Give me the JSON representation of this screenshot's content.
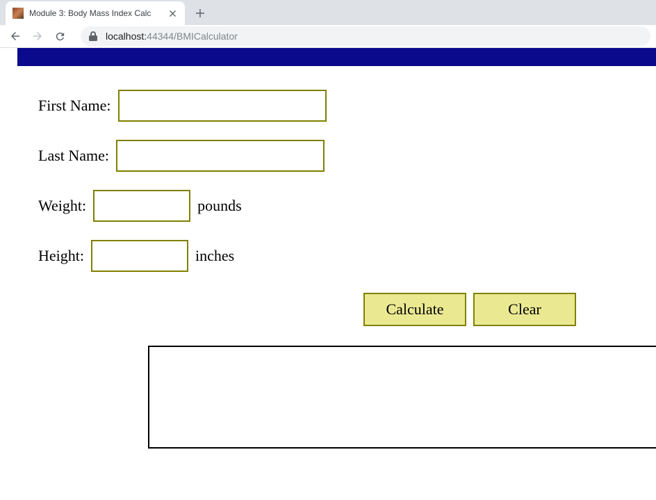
{
  "browser": {
    "tab_title": "Module 3: Body Mass Index Calc",
    "url_host": "localhost:",
    "url_port_path": "44344/BMICalculator"
  },
  "form": {
    "first_name_label": "First Name:",
    "first_name_value": "",
    "last_name_label": "Last Name:",
    "last_name_value": "",
    "weight_label": "Weight:",
    "weight_value": "",
    "weight_unit": "pounds",
    "height_label": "Height:",
    "height_value": "",
    "height_unit": "inches"
  },
  "buttons": {
    "calculate_label": "Calculate",
    "clear_label": "Clear"
  },
  "result": {
    "text": ""
  }
}
